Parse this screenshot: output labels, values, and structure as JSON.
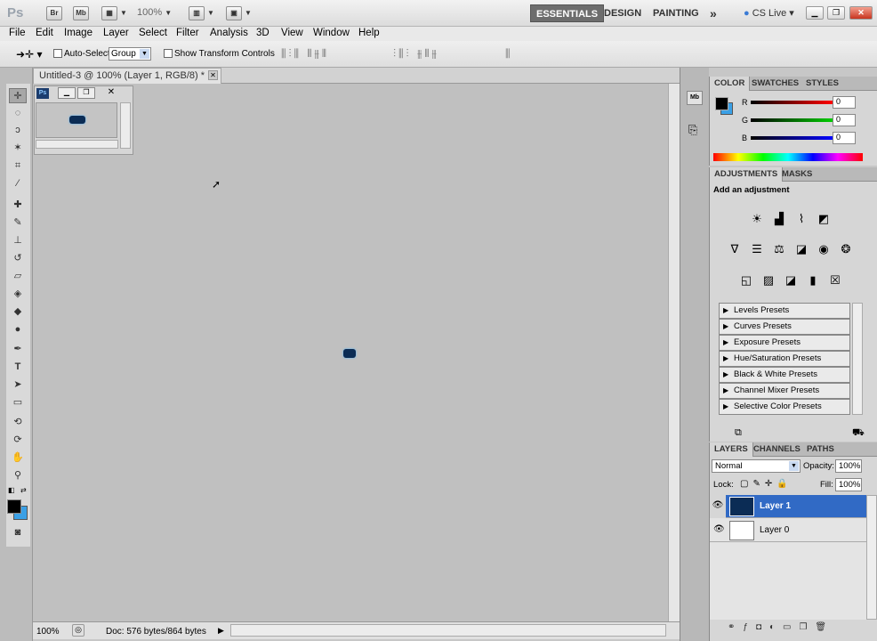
{
  "app": {
    "logo": "Ps",
    "bridge": "Br",
    "minibridge": "Mb",
    "zoom": "100%",
    "workspaces": [
      "ESSENTIALS",
      "DESIGN",
      "PAINTING"
    ],
    "more": "»",
    "cslive": "CS Live"
  },
  "menu": [
    "File",
    "Edit",
    "Image",
    "Layer",
    "Select",
    "Filter",
    "Analysis",
    "3D",
    "View",
    "Window",
    "Help"
  ],
  "options": {
    "auto_select_label": "Auto-Select:",
    "auto_select_value": "Group",
    "transform_label": "Show Transform Controls"
  },
  "document": {
    "tab_title": "Untitled-3 @ 100% (Layer 1, RGB/8) *",
    "close": "✕",
    "status_zoom": "100%",
    "status_doc": "Doc: 576 bytes/864 bytes"
  },
  "navigator": {
    "logo": "Ps"
  },
  "color_panel": {
    "tabs": [
      "COLOR",
      "SWATCHES",
      "STYLES"
    ],
    "r_label": "R",
    "g_label": "G",
    "b_label": "B",
    "r": "0",
    "g": "0",
    "b": "0"
  },
  "adjustments": {
    "tabs": [
      "ADJUSTMENTS",
      "MASKS"
    ],
    "heading": "Add an adjustment",
    "presets": [
      "Levels Presets",
      "Curves Presets",
      "Exposure Presets",
      "Hue/Saturation Presets",
      "Black & White Presets",
      "Channel Mixer Presets",
      "Selective Color Presets"
    ]
  },
  "layers_panel": {
    "tabs": [
      "LAYERS",
      "CHANNELS",
      "PATHS"
    ],
    "blend_mode": "Normal",
    "opacity_label": "Opacity:",
    "opacity": "100%",
    "lock_label": "Lock:",
    "fill_label": "Fill:",
    "fill": "100%",
    "layers": [
      {
        "name": "Layer 1",
        "selected": true
      },
      {
        "name": "Layer 0",
        "selected": false
      }
    ]
  },
  "colors": {
    "selection_blue": "#316ac5",
    "foreground": "#000000",
    "background": "#3aa0e6"
  }
}
